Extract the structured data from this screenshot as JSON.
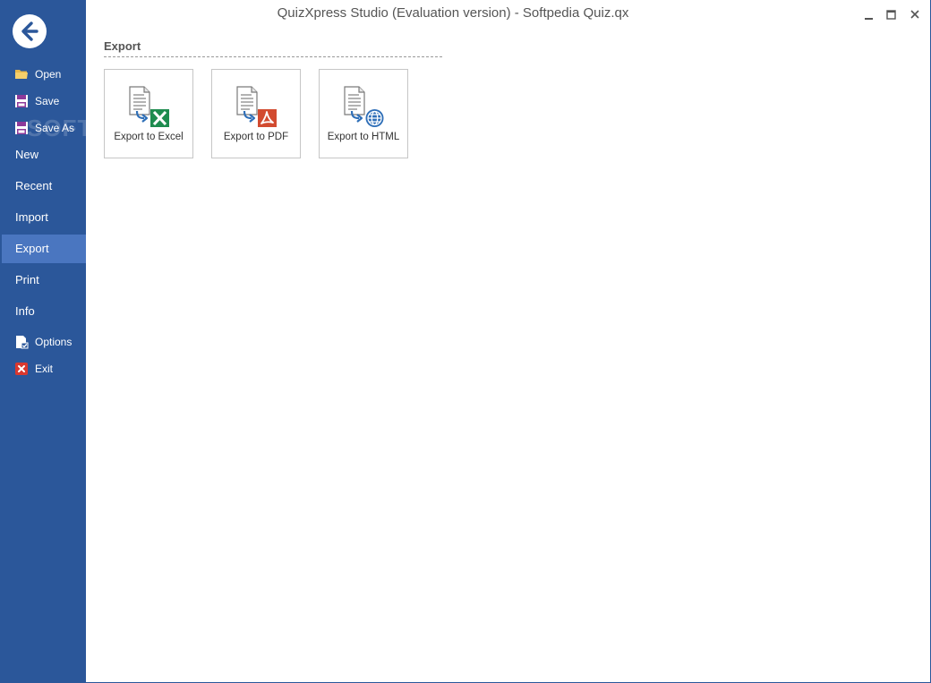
{
  "window": {
    "title": "QuizXpress Studio (Evaluation version) - Softpedia Quiz.qx",
    "controls": [
      "minimize-icon",
      "maximize-icon",
      "close-icon"
    ]
  },
  "sidebar": {
    "back_icon": "back-arrow-icon",
    "watermark": "SOFTPEDIA",
    "items": [
      {
        "label": "Open",
        "icon": "folder-icon"
      },
      {
        "label": "Save",
        "icon": "save-icon"
      },
      {
        "label": "Save As",
        "icon": "save-as-icon"
      },
      {
        "label": "New"
      },
      {
        "label": "Recent"
      },
      {
        "label": "Import"
      },
      {
        "label": "Export",
        "active": true
      },
      {
        "label": "Print"
      },
      {
        "label": "Info"
      },
      {
        "label": "Options",
        "icon": "options-icon"
      },
      {
        "label": "Exit",
        "icon": "exit-icon"
      }
    ]
  },
  "main": {
    "section_title": "Export",
    "tiles": [
      {
        "label": "Export to Excel",
        "icon": "excel-document-icon"
      },
      {
        "label": "Export to PDF",
        "icon": "pdf-document-icon"
      },
      {
        "label": "Export to HTML",
        "icon": "html-document-icon"
      }
    ]
  },
  "colors": {
    "sidebar": "#2b579a",
    "sidebar_active": "#4a76c0",
    "excel": "#1e8c4f",
    "pdf": "#d24b30",
    "html": "#2f6fb8"
  }
}
